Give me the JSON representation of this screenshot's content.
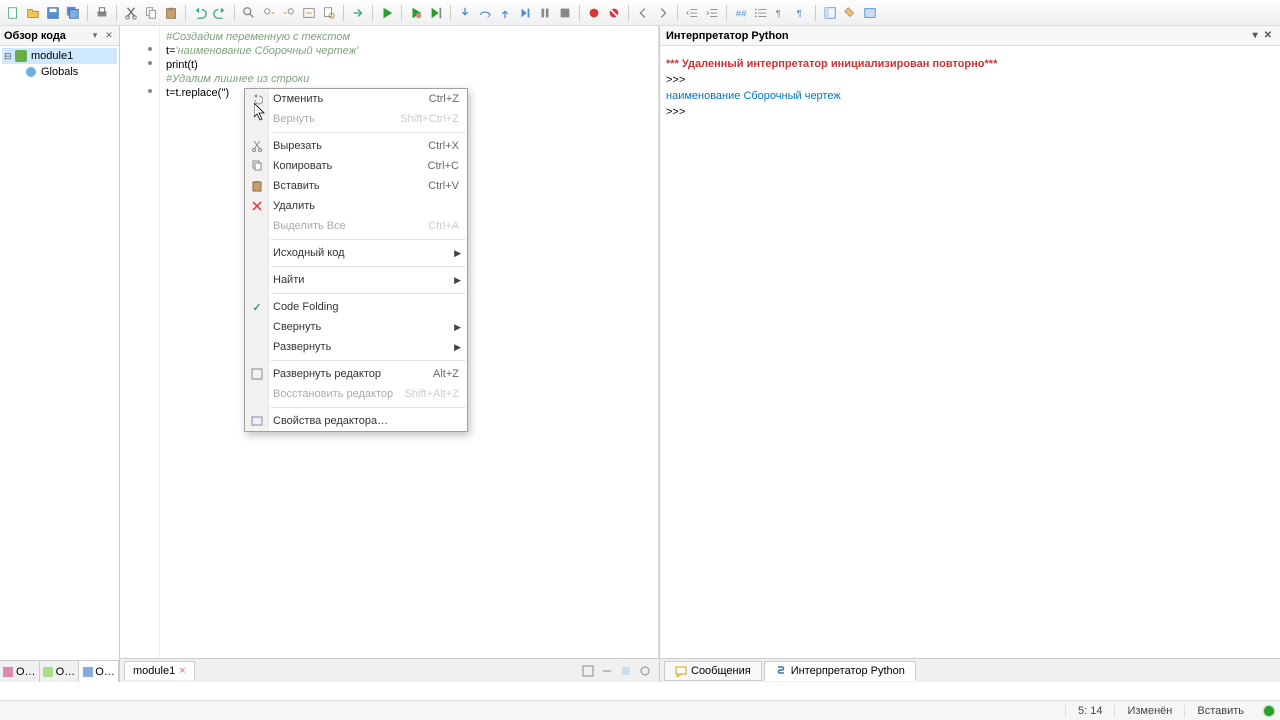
{
  "sidebar": {
    "title": "Обзор кода",
    "items": [
      {
        "label": "module1",
        "selected": true,
        "icon": "module"
      },
      {
        "label": "Globals",
        "selected": false,
        "icon": "globals"
      }
    ]
  },
  "left_tabs": [
    "О…",
    "О…",
    "О…"
  ],
  "editor": {
    "tab_label": "module1",
    "lines": {
      "l1": "#Создадим переменную с текстом",
      "l2_pre": "t=",
      "l2_str": "'наименование Сборочный чертеж'",
      "l3": "print(t)",
      "l4": "#Удалим лишнее из строки",
      "l5": "t=t.replace('')"
    }
  },
  "context_menu": {
    "undo": {
      "label": "Отменить",
      "shortcut": "Ctrl+Z"
    },
    "redo": {
      "label": "Вернуть",
      "shortcut": "Shift+Ctrl+Z"
    },
    "cut": {
      "label": "Вырезать",
      "shortcut": "Ctrl+X"
    },
    "copy": {
      "label": "Копировать",
      "shortcut": "Ctrl+C"
    },
    "paste": {
      "label": "Вставить",
      "shortcut": "Ctrl+V"
    },
    "delete": {
      "label": "Удалить"
    },
    "selectall": {
      "label": "Выделить Все",
      "shortcut": "Ctrl+A"
    },
    "source": {
      "label": "Исходный код"
    },
    "find": {
      "label": "Найти"
    },
    "folding": {
      "label": "Code Folding"
    },
    "collapse": {
      "label": "Свернуть"
    },
    "expand": {
      "label": "Развернуть"
    },
    "maximize": {
      "label": "Развернуть редактор",
      "shortcut": "Alt+Z"
    },
    "restore": {
      "label": "Восстановить редактор",
      "shortcut": "Shift+Alt+Z"
    },
    "options": {
      "label": "Свойства редактора…"
    }
  },
  "interpreter": {
    "title": "Интерпретатор Python",
    "line1": "*** Удаленный интерпретатор инициализирован повторно***",
    "prompt": ">>>",
    "output": "наименование Сборочный чертеж",
    "tabs": {
      "messages": "Сообщения",
      "interp": "Интерпретатор Python"
    }
  },
  "statusbar": {
    "pos": "5: 14",
    "modified": "Изменён",
    "insert": "Вставить"
  }
}
